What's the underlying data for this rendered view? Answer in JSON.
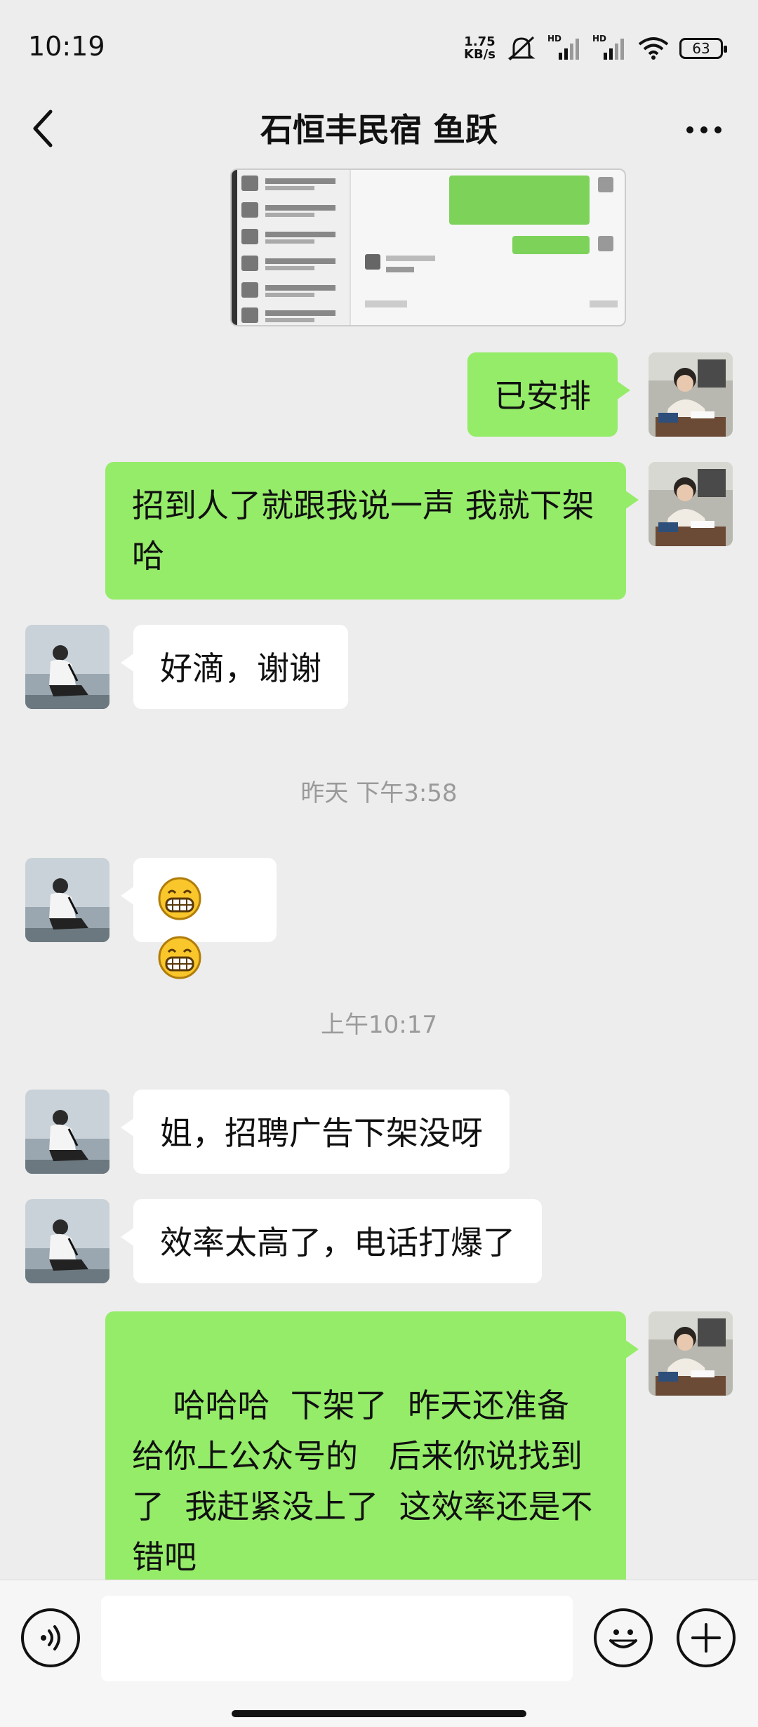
{
  "status_bar": {
    "time": "10:19",
    "net_speed_value": "1.75",
    "net_speed_unit": "KB/s",
    "hd1": "HD",
    "hd2": "HD",
    "battery": "63",
    "icons": [
      "mute-bell-icon",
      "signal-icon",
      "signal-icon",
      "wifi-icon",
      "battery-icon"
    ]
  },
  "header": {
    "title": "石恒丰民宿 鱼跃",
    "back_icon": "chevron-left-icon",
    "more_icon": "more-dots-icon"
  },
  "messages": [
    {
      "side": "right",
      "type": "image",
      "description_icon": "screenshot-thumbnail"
    },
    {
      "side": "right",
      "type": "text",
      "text": "已安排"
    },
    {
      "side": "right",
      "type": "text",
      "text": "招到人了就跟我说一声 我就下架哈"
    },
    {
      "side": "left",
      "type": "text",
      "text": "好滴，谢谢"
    },
    {
      "type": "timestamp",
      "text": "昨天 下午3:58"
    },
    {
      "side": "left",
      "type": "emoji",
      "emoji_names": [
        "grin-icon",
        "grin-icon"
      ]
    },
    {
      "type": "timestamp",
      "text": "上午10:17"
    },
    {
      "side": "left",
      "type": "text",
      "text": "姐，招聘广告下架没呀"
    },
    {
      "side": "left",
      "type": "text",
      "text": "效率太高了，电话打爆了"
    },
    {
      "side": "right",
      "type": "text",
      "text": "哈哈哈  下架了  昨天还准备给你上公众号的   后来你说找到了  我赶紧没上了  这效率还是不错吧"
    }
  ],
  "input_bar": {
    "voice_icon": "voice-icon",
    "input_value": "",
    "emoji_icon": "smiley-icon",
    "plus_icon": "plus-icon"
  },
  "colors": {
    "background": "#ededed",
    "bubble_green": "#95ec69",
    "bubble_white": "#ffffff",
    "timestamp": "#9a9a9a"
  }
}
